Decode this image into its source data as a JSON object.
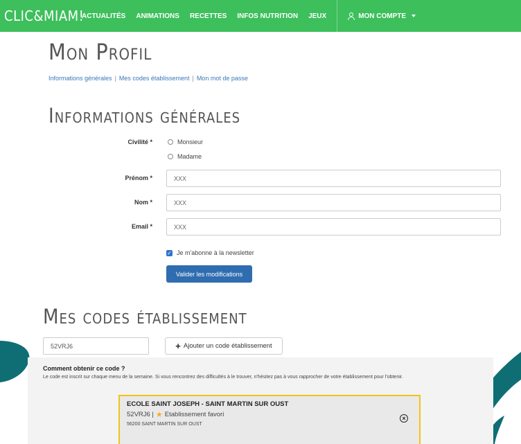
{
  "nav": {
    "logo": "CLIC&MIAM!",
    "items": [
      "ACTUALITÉS",
      "ANIMATIONS",
      "RECETTES",
      "INFOS NUTRITION",
      "JEUX"
    ],
    "account": "MON COMPTE"
  },
  "page": {
    "title": "Mon Profil",
    "subnav": [
      "Informations générales",
      "Mes codes établissement",
      "Mon mot de passe"
    ]
  },
  "info": {
    "title": "Informations générales",
    "civilite_label": "Civilité *",
    "civilite_options": [
      "Monsieur",
      "Madame"
    ],
    "prenom_label": "Prénom *",
    "prenom_value": "XXX",
    "nom_label": "Nom *",
    "nom_value": "XXX",
    "email_label": "Email *",
    "email_value": "XXX",
    "newsletter_label": "Je m'abonne à la newsletter",
    "submit": "Valider les modifications"
  },
  "codes": {
    "title": "Mes codes établissement",
    "input_value": "52VRJ6",
    "add_button": "Ajouter un code établissement",
    "howto_title": "Comment obtenir ce code ?",
    "howto_text": "Le code est inscrit sur chaque menu de la semaine. Si vous rencontrez des difficultés à le trouver, n'hésitez pas à vous rapprocher de votre établissement pour l'obtenir.",
    "card": {
      "name": "ECOLE SAINT JOSEPH - SAINT MARTIN SUR OUST",
      "code": "52VRJ6 |",
      "favorite": "Etablissement favori",
      "address": "56200 SAINT MARTIN SUR OUST"
    }
  },
  "colors": {
    "nav_green": "#3dbf5c",
    "primary_blue": "#2f6db0",
    "favorite_yellow": "#f2c21b",
    "deco_teal": "#0f6e74"
  }
}
